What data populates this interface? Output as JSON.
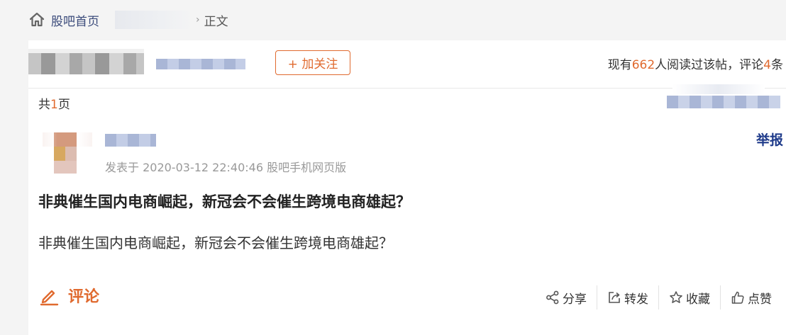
{
  "breadcrumb": {
    "home_label": "股吧首页",
    "current_label": "正文",
    "separator": "›"
  },
  "author_bar": {
    "follow_button": "+ 加关注",
    "read_prefix": "现有",
    "read_count": "662",
    "read_mid": "人阅读过该帖，评论",
    "comment_count": "4",
    "read_suffix": "条"
  },
  "paging": {
    "prefix": "共",
    "pages": "1",
    "suffix": "页"
  },
  "post": {
    "report_label": "举报",
    "meta": "发表于 2020-03-12 22:40:46 股吧手机网页版",
    "title": "非典催生国内电商崛起，新冠会不会催生跨境电商雄起？",
    "body": "非典催生国内电商崛起，新冠会不会催生跨境电商雄起？"
  },
  "footer": {
    "comment_label": "评论",
    "actions": [
      {
        "label": "分享",
        "icon": "share-icon"
      },
      {
        "label": "转发",
        "icon": "forward-icon"
      },
      {
        "label": "收藏",
        "icon": "star-icon"
      },
      {
        "label": "点赞",
        "icon": "thumbs-up-icon"
      }
    ]
  },
  "colors": {
    "accent": "#e06a2f",
    "link": "#3a4a7a",
    "report": "#1e3a8a"
  }
}
